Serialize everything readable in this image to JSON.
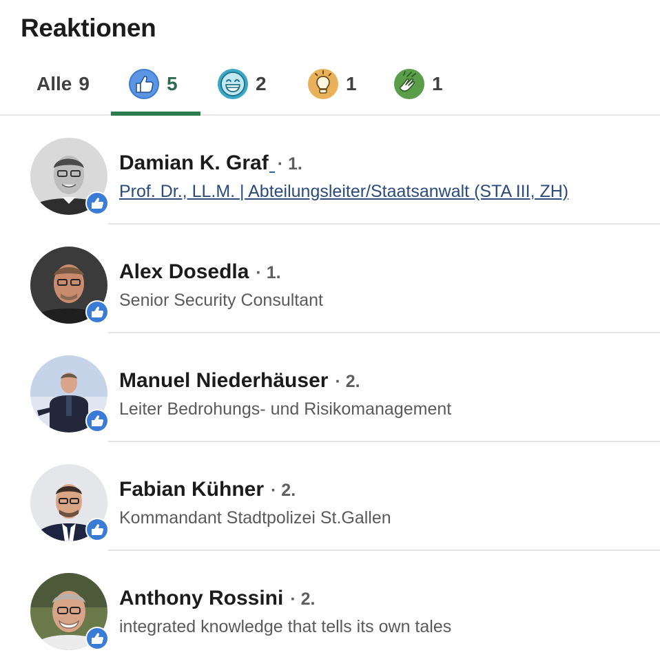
{
  "title": "Reaktionen",
  "tabs": {
    "all": {
      "label": "Alle",
      "count": "9"
    },
    "like": {
      "icon": "like-icon",
      "count": "5"
    },
    "funny": {
      "icon": "laughing-face-icon",
      "count": "2"
    },
    "insightful": {
      "icon": "lightbulb-icon",
      "count": "1"
    },
    "celebrate": {
      "icon": "clapping-hands-icon",
      "count": "1"
    }
  },
  "colors": {
    "active_tab_accent": "#2e7d4f",
    "like_blue": "#3a7bd5",
    "link_blue": "#2a4b7c"
  },
  "people": [
    {
      "name": "Damian K. Graf",
      "degree": "· 1.",
      "headline": "Prof. Dr., LL.M. | Abteilungsleiter/Staatsanwalt (STA III, ZH)",
      "reaction": "like-icon"
    },
    {
      "name": "Alex Dosedla",
      "degree": "· 1.",
      "headline": "Senior Security Consultant",
      "reaction": "like-icon"
    },
    {
      "name": "Manuel Niederhäuser",
      "degree": "· 2.",
      "headline": "Leiter Bedrohungs- und Risikomanagement",
      "reaction": "like-icon"
    },
    {
      "name": "Fabian Kühner",
      "degree": "· 2.",
      "headline": "Kommandant Stadtpolizei St.Gallen",
      "reaction": "like-icon"
    },
    {
      "name": "Anthony Rossini",
      "degree": "· 2.",
      "headline": "integrated knowledge that tells its own tales",
      "reaction": "like-icon"
    }
  ]
}
